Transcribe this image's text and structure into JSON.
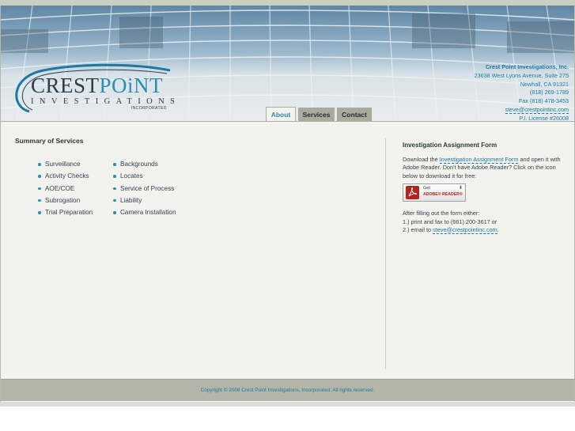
{
  "company": {
    "logo_line1_a": "CREST",
    "logo_line1_b": "POiNT",
    "logo_line2": "INVESTIGATIONS",
    "logo_line3": "INCORPORATED",
    "name": "Crest Point Investigations, Inc.",
    "address": "23638 West Lyons Avenue, Suite 275",
    "city": "Newhall, CA 91321",
    "phone": "(818) 269-1789",
    "fax": "Fax (818) 478-3453",
    "email": "steve@crestpointinc.com",
    "license": "P.I. License #26008"
  },
  "tabs": [
    {
      "label": "About",
      "active": true
    },
    {
      "label": "Services",
      "active": false
    },
    {
      "label": "Contact",
      "active": false
    }
  ],
  "summary": {
    "title": "Summary of Services",
    "col1": [
      "Surveillance",
      "Activity Checks",
      "AOE/COE",
      "Subrogation",
      "Trial Preparation"
    ],
    "col2": [
      "Backgrounds",
      "Locates",
      "Service of Process",
      "Liability",
      "Camera Installation"
    ]
  },
  "form": {
    "title": "Investigation Assignment Form",
    "text1_a": "Download the ",
    "link_text": "Investigation Assignment Form",
    "text1_b": " and open it with Adobe Reader. Don't have Adobe Reader? Click on the icon below to download it for free:",
    "adobe_get": "Get",
    "adobe_reader": "ADOBE® READER®",
    "after_text": "After filling out the form either:",
    "option1": "1.) print and fax to (661) 200-3617 or",
    "option2_a": "2.) email to ",
    "option2_email": "steve@crestpointinc.com",
    "option2_b": "."
  },
  "footer": {
    "copyright": "Copyright © 2008 Crest Point Investigations, Incorporated. All rights reserved."
  },
  "colors": {
    "accent": "#2c8fb0",
    "link": "#1c7aa0",
    "footer_bg": "#b3b5a8",
    "page_bg": "#f2f2ee"
  }
}
